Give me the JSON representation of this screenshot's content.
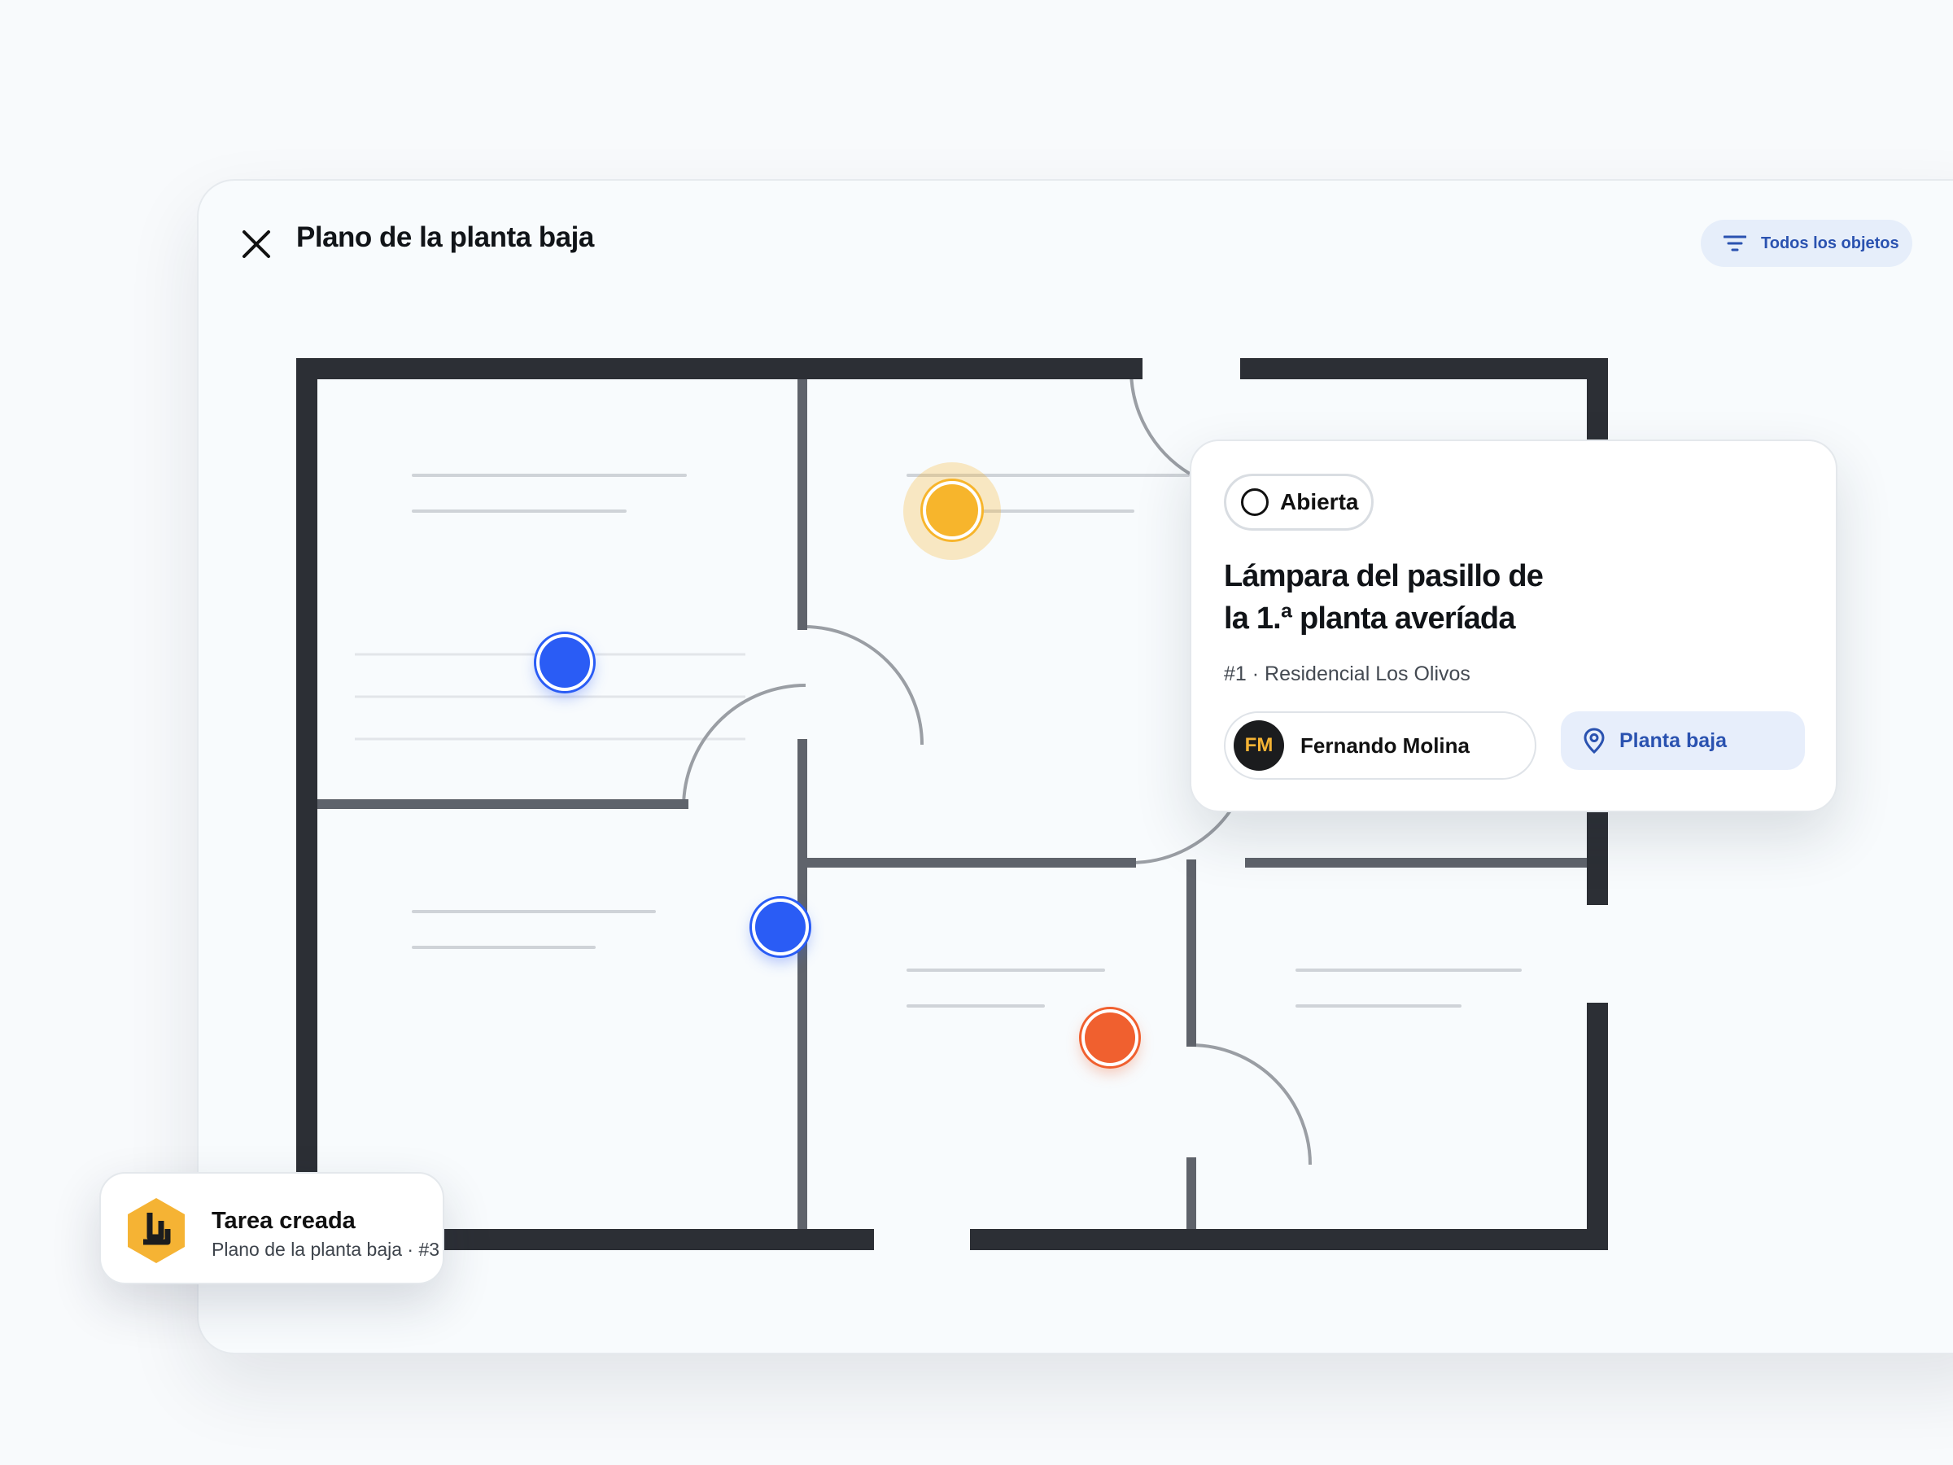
{
  "header": {
    "title": "Plano de la planta baja",
    "filter_label": "Todos los objetos"
  },
  "pins": [
    {
      "status": "warning",
      "color": "#f7b52c"
    },
    {
      "status": "default",
      "color": "#2a5cf5"
    },
    {
      "status": "default",
      "color": "#2a5cf5"
    },
    {
      "status": "error",
      "color": "#f0602f"
    }
  ],
  "task_card": {
    "status": "Abierta",
    "title_line1": "Lámpara del pasillo de",
    "title_line2": "la 1.ª planta averíada",
    "meta": "#1 · Residencial Los Olivos",
    "assignee_initials": "FM",
    "assignee_name": "Fernando Molina",
    "location": "Planta baja"
  },
  "toast": {
    "title": "Tarea creada",
    "subtitle": "Plano de la planta baja · #3"
  },
  "colors": {
    "accent": "#2a52b0",
    "wall_dark": "#2c2f35",
    "wall_inner": "#5f636b",
    "brand_yellow": "#f5b334"
  }
}
